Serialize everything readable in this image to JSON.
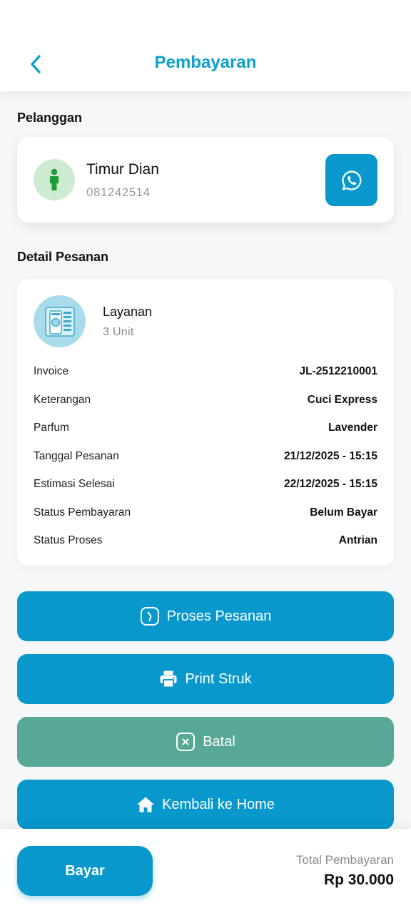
{
  "header": {
    "title": "Pembayaran",
    "back_icon": "chevron-left-icon"
  },
  "customer": {
    "section_label": "Pelanggan",
    "name": "Timur Dian",
    "phone": "081242514",
    "avatar_icon": "person-icon",
    "whatsapp_icon": "whatsapp-icon"
  },
  "order": {
    "section_label": "Detail Pesanan",
    "service_name": "Layanan",
    "service_qty": "3 Unit",
    "service_icon": "laundry-machine-icon",
    "rows": [
      {
        "label": "Invoice",
        "value": "JL-2512210001"
      },
      {
        "label": "Keterangan",
        "value": "Cuci Express"
      },
      {
        "label": "Parfum",
        "value": "Lavender"
      },
      {
        "label": "Tanggal Pesanan",
        "value": "21/12/2025 - 15:15"
      },
      {
        "label": "Estimasi Selesai",
        "value": "22/12/2025 - 15:15"
      },
      {
        "label": "Status Pembayaran",
        "value": "Belum Bayar"
      },
      {
        "label": "Status Proses",
        "value": "Antrian"
      }
    ]
  },
  "actions": {
    "process_label": "Proses Pesanan",
    "print_label": "Print Struk",
    "cancel_label": "Batal",
    "home_label": "Kembali ke Home"
  },
  "footer": {
    "pay_label": "Bayar",
    "total_label": "Total Pembayaran",
    "total_value": "Rp 30.000"
  },
  "colors": {
    "primary": "#0898cc",
    "title": "#0aa0cc",
    "cancel": "#58a897",
    "avatar_bg": "#cdebd0",
    "avatar_fg": "#1f9a36"
  }
}
